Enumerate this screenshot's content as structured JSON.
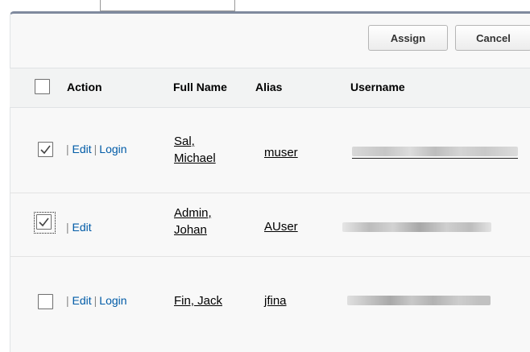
{
  "toolbar": {
    "assign_label": "Assign",
    "cancel_label": "Cancel"
  },
  "table": {
    "columns": {
      "action": "Action",
      "full_name": "Full Name",
      "alias": "Alias",
      "username": "Username"
    },
    "rows": [
      {
        "checked": true,
        "focused": false,
        "edit": "Edit",
        "login": "Login",
        "name_line1": "Sal,",
        "name_line2": "Michael",
        "alias": "muser",
        "sep": "|"
      },
      {
        "checked": true,
        "focused": true,
        "edit": "Edit",
        "login": "",
        "name_line1": "Admin,",
        "name_line2": "Johan",
        "alias": "AUser",
        "sep": "|"
      },
      {
        "checked": false,
        "focused": false,
        "edit": "Edit",
        "login": "Login",
        "name_line1": "Fin, Jack",
        "name_line2": "",
        "alias": "jfina",
        "sep": "|"
      }
    ]
  },
  "colors": {
    "link_blue": "#015ba7",
    "panel_border": "#7f8a9e"
  }
}
